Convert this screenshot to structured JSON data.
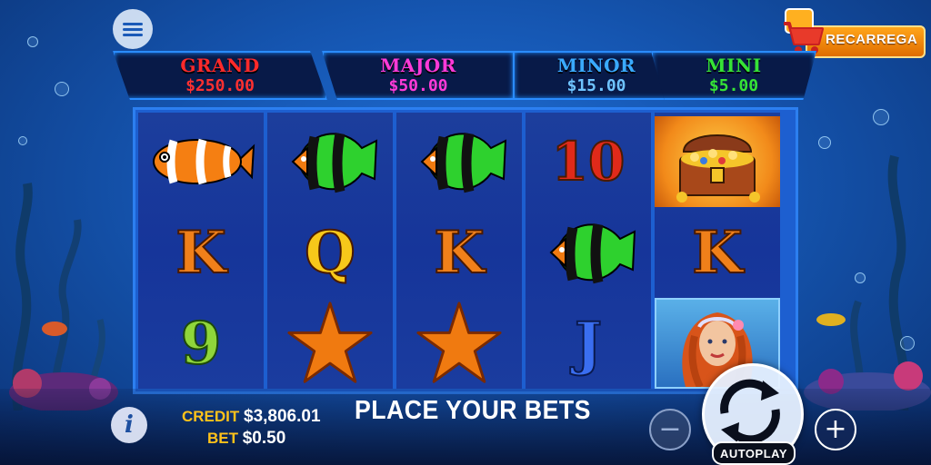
{
  "colors": {
    "accent_blue": "#2a8cff",
    "gold": "#ffc21a",
    "orange": "#f07a10"
  },
  "header": {
    "menu_icon": "hamburger-menu-icon",
    "recharge_label": "RECARREGA",
    "recharge_icon": "shopping-cart-icon"
  },
  "jackpots": [
    {
      "name": "GRAND",
      "value": "$250.00",
      "name_color": "#ff2a2a",
      "value_color": "#ff3030"
    },
    {
      "name": "MAJOR",
      "value": "$50.00",
      "name_color": "#ff3ad8",
      "value_color": "#ff3ad8"
    },
    {
      "name": "MINOR",
      "value": "$15.00",
      "name_color": "#3aaaff",
      "value_color": "#6fc4ff"
    },
    {
      "name": "MINI",
      "value": "$5.00",
      "name_color": "#36e336",
      "value_color": "#36e336"
    }
  ],
  "reels": [
    [
      "clownfish",
      "K",
      "9"
    ],
    [
      "angelfish",
      "Q",
      "starfish"
    ],
    [
      "angelfish",
      "K",
      "starfish"
    ],
    [
      "10",
      "angelfish",
      "J"
    ],
    [
      "treasure-chest",
      "K",
      "mermaid"
    ]
  ],
  "footer": {
    "info_icon": "info-icon",
    "credit_label": "CREDIT",
    "credit_value": "$3,806.01",
    "bet_label": "BET",
    "bet_value": "$0.50",
    "message": "PLACE YOUR BETS",
    "minus_icon": "minus-icon",
    "plus_icon": "plus-icon",
    "spin_icon": "spin-arrows-icon",
    "autoplay_label": "AUTOPLAY"
  }
}
